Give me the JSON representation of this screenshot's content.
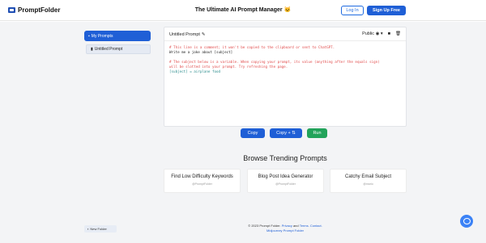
{
  "header": {
    "brand": "PromptFolder",
    "title": "The Ultimate AI Prompt Manager",
    "title_icon": "🐱",
    "login": "Log In",
    "signup": "Sign Up Free"
  },
  "sidebar": {
    "folder": "My Prompts",
    "prompt": "Untitled Prompt",
    "new_folder": "New Folder"
  },
  "editor": {
    "title": "Untitled Prompt",
    "visibility": "Public",
    "lines": [
      {
        "text": "# This line is a comment; it won't be copied to the clipboard or sent to ChatGPT.",
        "style": "red"
      },
      {
        "text": "Write me a joke about [subject]",
        "style": "blk"
      },
      {
        "text": "",
        "style": "blk"
      },
      {
        "text": "# The subject below is a variable. When copying your prompt, its value (anything after the equals sign)",
        "style": "red"
      },
      {
        "text": "will be slotted into your prompt. Try refreshing the page.",
        "style": "red"
      },
      {
        "text": "[subject] = airplane food",
        "style": "teal"
      }
    ]
  },
  "actions": {
    "copy": "Copy",
    "copy_plus": "Copy + ⇅",
    "run": "Run"
  },
  "trending": {
    "title": "Browse Trending Prompts",
    "cards": [
      {
        "title": "Find Low Difficulty Keywords",
        "sub": "@PromptFolder"
      },
      {
        "title": "Blog Post Idea Generator",
        "sub": "@PromptFolder"
      },
      {
        "title": "Catchy Email Subject",
        "sub": "@mario"
      }
    ]
  },
  "footer": {
    "line1_pre": "© 2023 Prompt Folder.",
    "privacy": "Privacy",
    "and": "and",
    "terms": "Terms.",
    "contact": "Contact.",
    "line2": "Midjourney Prompt Folder"
  },
  "colors": {
    "primary": "#1f5fd6",
    "run": "#22a35a"
  }
}
